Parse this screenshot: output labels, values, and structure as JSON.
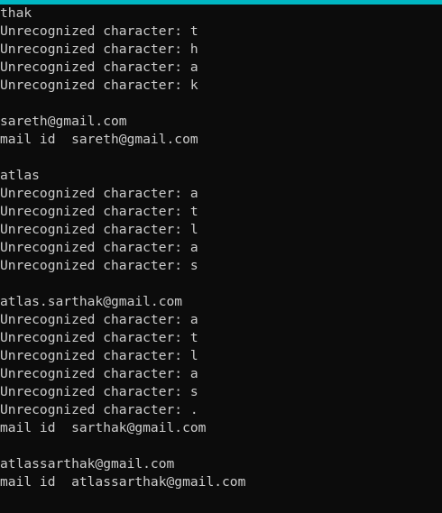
{
  "colors": {
    "accent": "#00b7c3",
    "background": "#0c0c0c",
    "text": "#cccccc"
  },
  "console": {
    "lines": [
      "thak",
      "Unrecognized character: t",
      "Unrecognized character: h",
      "Unrecognized character: a",
      "Unrecognized character: k",
      "",
      "sareth@gmail.com",
      "mail id  sareth@gmail.com",
      "",
      "atlas",
      "Unrecognized character: a",
      "Unrecognized character: t",
      "Unrecognized character: l",
      "Unrecognized character: a",
      "Unrecognized character: s",
      "",
      "atlas.sarthak@gmail.com",
      "Unrecognized character: a",
      "Unrecognized character: t",
      "Unrecognized character: l",
      "Unrecognized character: a",
      "Unrecognized character: s",
      "Unrecognized character: .",
      "mail id  sarthak@gmail.com",
      "",
      "atlassarthak@gmail.com",
      "mail id  atlassarthak@gmail.com"
    ]
  }
}
